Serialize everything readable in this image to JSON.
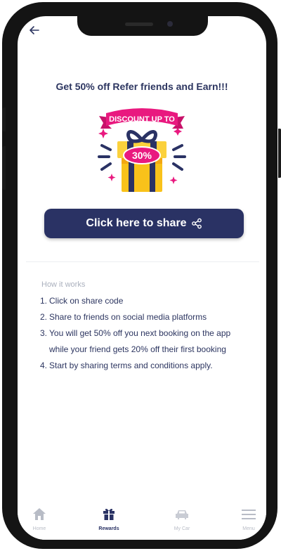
{
  "page": {
    "headline": "Get 50% off Refer friends and Earn!!!",
    "share_button_label": "Click here to share"
  },
  "promo_image": {
    "banner_text": "DISCOUNT UP TO",
    "badge_text": "30%"
  },
  "how_it_works": {
    "title": "How it works",
    "steps": [
      {
        "num": "1.",
        "text": "Click on share code"
      },
      {
        "num": "2.",
        "text": "Share to friends on social media platforms"
      },
      {
        "num": "3.",
        "text": "You will get 50% off you next booking on the app while your friend gets 20% off their first booking"
      },
      {
        "num": "4.",
        "text": "Start by sharing terms and conditions apply."
      }
    ]
  },
  "bottom_nav": {
    "items": [
      {
        "label": "Home",
        "icon": "home-icon"
      },
      {
        "label": "Rewards",
        "icon": "gift-icon",
        "active": true
      },
      {
        "label": "My Car",
        "icon": "car-icon"
      },
      {
        "label": "Menu",
        "icon": "menu-icon"
      }
    ]
  },
  "colors": {
    "primary": "#2a3264",
    "heading_text": "#2c3560",
    "muted_text": "#aab0bd",
    "accent_pink": "#e9197f",
    "gift_yellow": "#f9c21a"
  }
}
